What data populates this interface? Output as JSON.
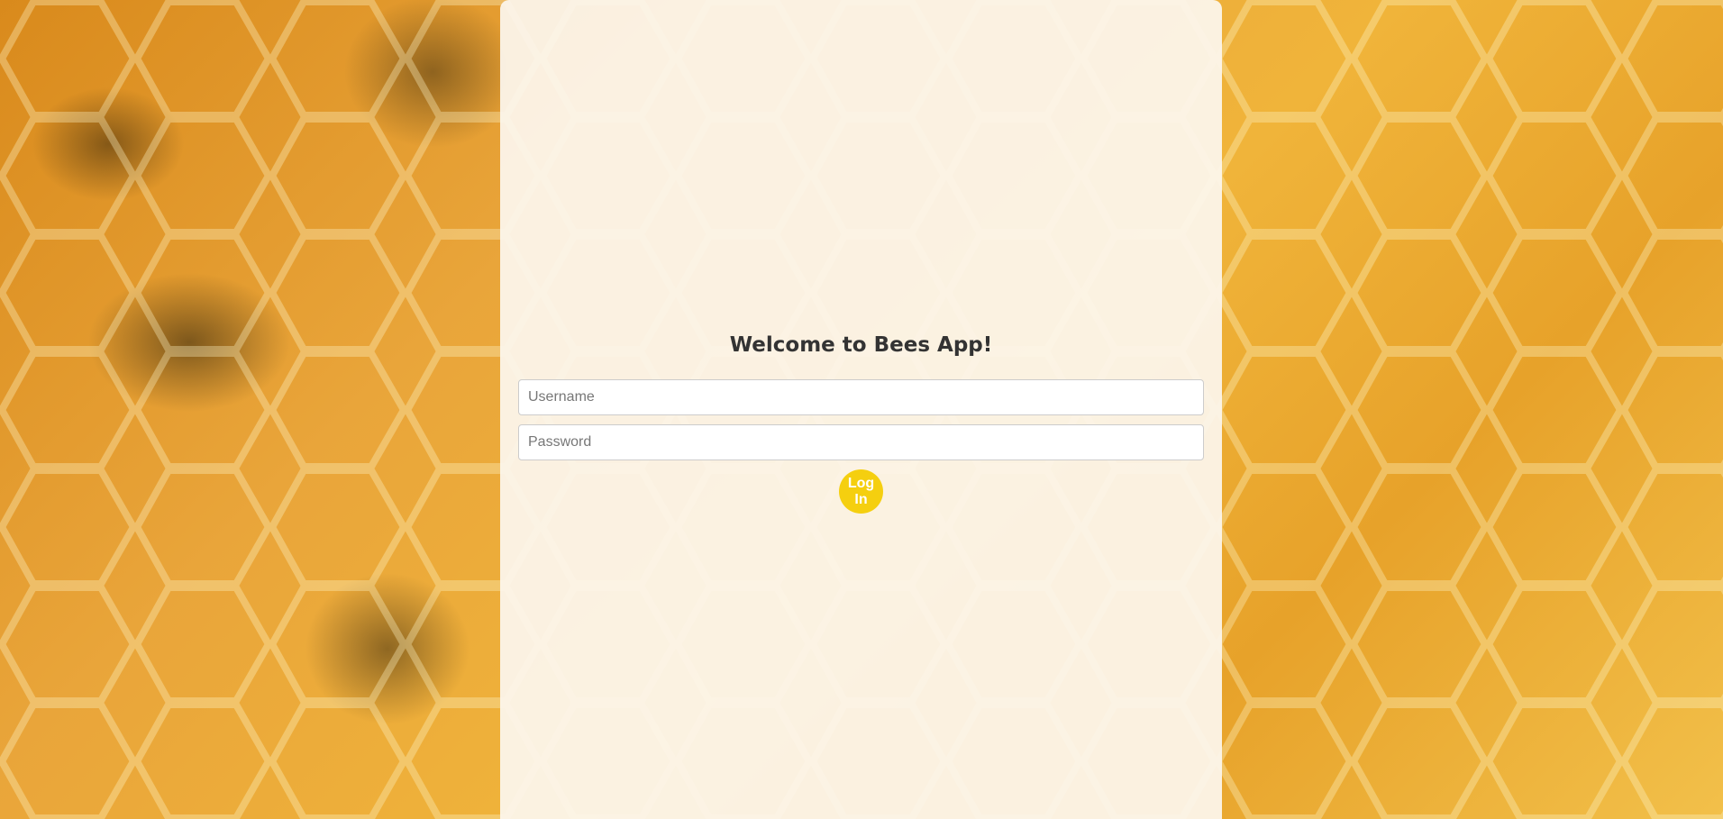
{
  "background": {
    "description_icon": "honeycomb-bees-photo",
    "colors": {
      "honey": "#e9a53a",
      "card": "#fcf6ee",
      "button": "#f5cf0f"
    }
  },
  "login": {
    "title": "Welcome to Bees App!",
    "username_placeholder": "Username",
    "password_placeholder": "Password",
    "submit_label": "Log In"
  }
}
